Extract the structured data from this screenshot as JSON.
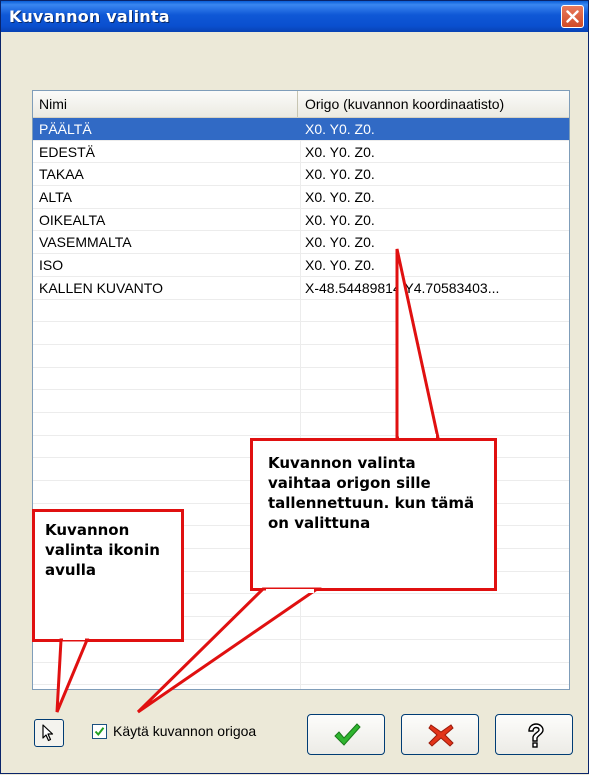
{
  "window": {
    "title": "Kuvannon valinta"
  },
  "list": {
    "columns": [
      "Nimi",
      "Origo (kuvannon koordinaatisto)"
    ],
    "rows": [
      {
        "name": "PÄÄLTÄ",
        "origin": "X0. Y0. Z0.",
        "selected": true
      },
      {
        "name": "EDESTÄ",
        "origin": "X0. Y0. Z0."
      },
      {
        "name": "TAKAA",
        "origin": "X0. Y0. Z0."
      },
      {
        "name": "ALTA",
        "origin": "X0. Y0. Z0."
      },
      {
        "name": "OIKEALTA",
        "origin": "X0. Y0. Z0."
      },
      {
        "name": "VASEMMALTA",
        "origin": "X0. Y0. Z0."
      },
      {
        "name": "ISO",
        "origin": "X0. Y0. Z0."
      },
      {
        "name": "KALLEN KUVANTO",
        "origin": "X-48.54489814 Y4.70583403..."
      }
    ]
  },
  "callouts": {
    "left": "Kuvannon valinta ikonin avulla",
    "right": "Kuvannon valinta vaihtaa origon sille tallennettuun. kun tämä on valittuna"
  },
  "footer": {
    "use_origin_label": "Käytä kuvannon origoa",
    "use_origin_checked": true
  },
  "colors": {
    "selection": "#316ac5",
    "callout_border": "#e01010",
    "title_bar": "#0a4fcf"
  },
  "icons": {
    "close": "close-icon",
    "pointer": "cursor-pointer-icon",
    "ok": "checkmark-icon",
    "cancel": "red-x-icon",
    "help": "question-mark-icon"
  }
}
